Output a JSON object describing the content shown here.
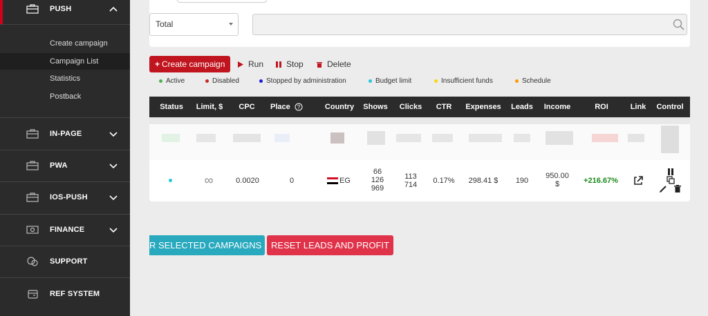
{
  "sidebar": {
    "sections": [
      {
        "label": "PUSH",
        "icon": "briefcase-icon",
        "chevron": "chevron-up-icon"
      },
      {
        "label": "IN-PAGE",
        "icon": "briefcase-icon",
        "chevron": "chevron-down-icon"
      },
      {
        "label": "PWA",
        "icon": "briefcase-icon",
        "chevron": "chevron-down-icon"
      },
      {
        "label": "IOS-PUSH",
        "icon": "briefcase-icon",
        "chevron": "chevron-down-icon"
      },
      {
        "label": "FINANCE",
        "icon": "money-icon",
        "chevron": "chevron-down-icon"
      },
      {
        "label": "SUPPORT",
        "icon": "chat-icon",
        "chevron": ""
      },
      {
        "label": "REF SYSTEM",
        "icon": "wallet-icon",
        "chevron": ""
      }
    ],
    "push_items": [
      "Create campaign",
      "Campaign List",
      "Statistics",
      "Postback"
    ],
    "active_item": "Campaign List"
  },
  "filters": {
    "select_value": "Total",
    "search_value": ""
  },
  "toolbar": {
    "create_label": "Create campaign",
    "run_label": "Run",
    "stop_label": "Stop",
    "delete_label": "Delete"
  },
  "legend": [
    {
      "label": "Active",
      "color": "#4caf50"
    },
    {
      "label": "Disabled",
      "color": "#c62828"
    },
    {
      "label": "Stopped by administration",
      "color": "#1a1adb"
    },
    {
      "label": "Budget limit",
      "color": "#26c6da"
    },
    {
      "label": "Insufficient funds",
      "color": "#f5d90a"
    },
    {
      "label": "Schedule",
      "color": "#ff9800"
    }
  ],
  "table": {
    "headers": [
      "Status",
      "Limit, $",
      "CPC",
      "Place",
      "Country",
      "Shows",
      "Clicks",
      "CTR",
      "Expenses",
      "Leads",
      "Income",
      "ROI",
      "Link",
      "Control"
    ],
    "row": {
      "status_color": "#26c6da",
      "limit": "∞",
      "cpc": "0.0020",
      "place": "0",
      "country": "EG",
      "shows": "66 126 969",
      "clicks": "113 714",
      "ctr": "0.17%",
      "expenses": "298.41 $",
      "leads": "190",
      "income": "950.00 $",
      "roi": "+216.67%",
      "roi_color": "#1a8a1a"
    }
  },
  "actions": {
    "selected_label": "R SELECTED CAMPAIGNS",
    "reset_label": "RESET LEADS AND PROFIT"
  }
}
